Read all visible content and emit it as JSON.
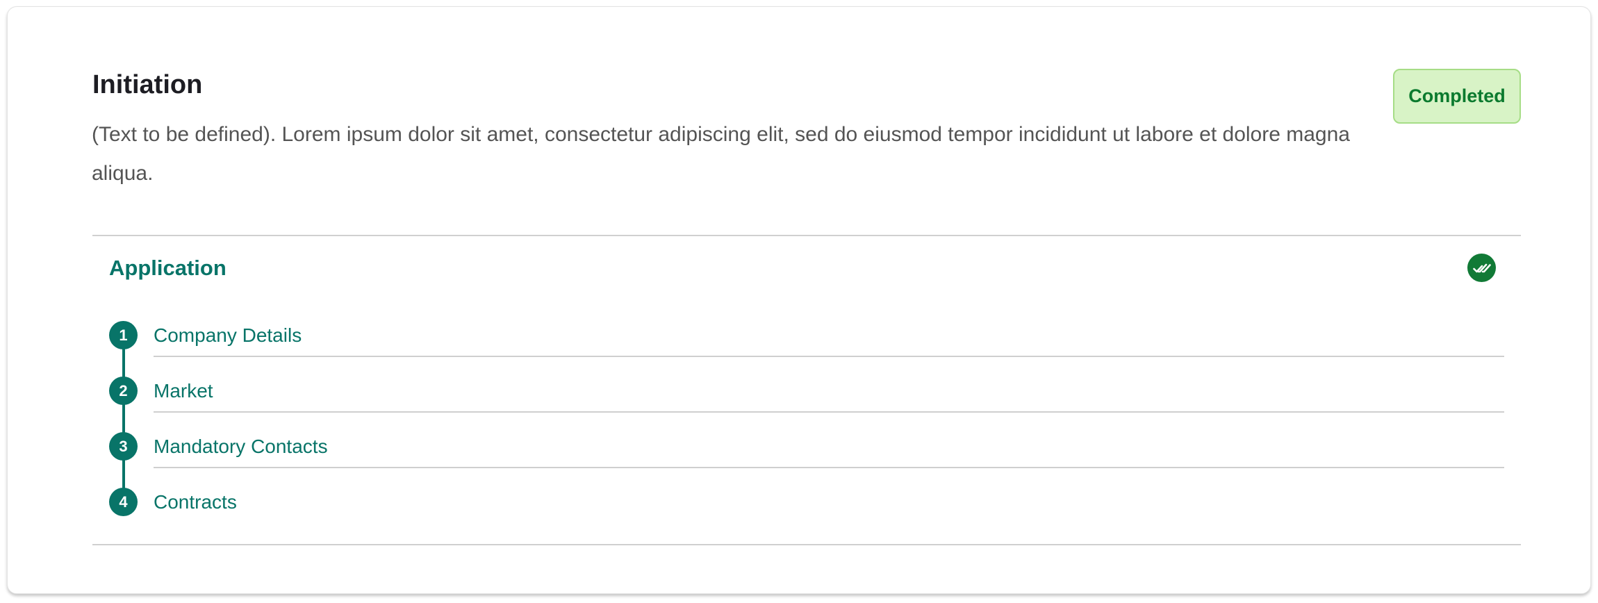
{
  "section": {
    "title": "Initiation",
    "description": "(Text to be defined). Lorem ipsum dolor sit amet, consectetur adipiscing elit, sed do eiusmod tempor incididunt ut labore et dolore magna aliqua.",
    "status": "Completed"
  },
  "application": {
    "title": "Application",
    "status_icon": "double-check-icon",
    "steps": [
      {
        "number": "1",
        "label": "Company Details"
      },
      {
        "number": "2",
        "label": "Market"
      },
      {
        "number": "3",
        "label": "Mandatory Contacts"
      },
      {
        "number": "4",
        "label": "Contracts"
      }
    ]
  },
  "colors": {
    "accent": "#087468",
    "success_text": "#0b7a2e",
    "success_bg": "#d8f3c6",
    "check_icon_bg": "#117a36",
    "title_text": "#1d1d23",
    "body_text": "#545454"
  }
}
